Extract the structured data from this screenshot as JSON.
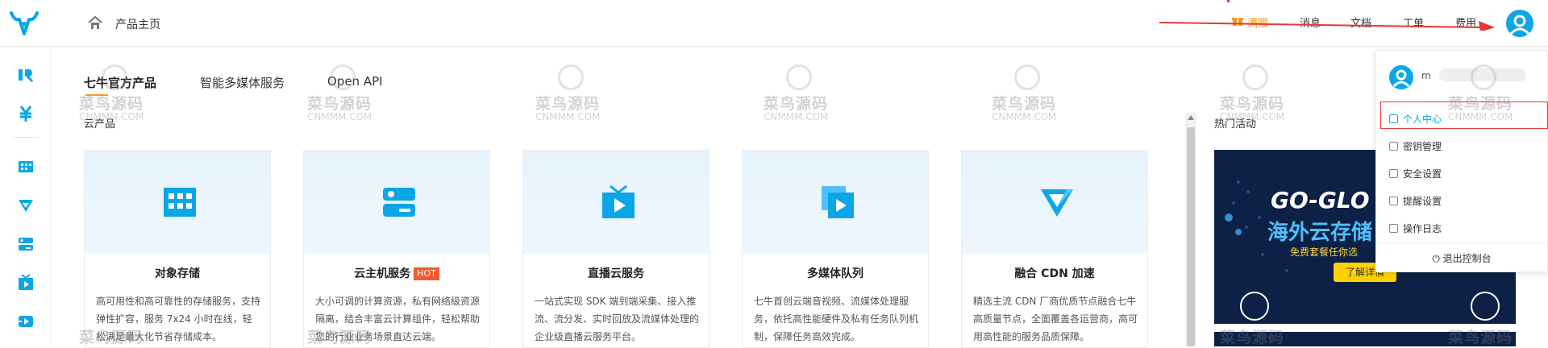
{
  "topbar": {
    "breadcrumb": "产品主页",
    "nav": [
      {
        "label": "满赠",
        "promo": true
      },
      {
        "label": "消息"
      },
      {
        "label": "文档"
      },
      {
        "label": "工单"
      },
      {
        "label": "费用"
      }
    ]
  },
  "tabs": [
    {
      "label": "七牛官方产品",
      "active": true
    },
    {
      "label": "智能多媒体服务"
    },
    {
      "label": "Open API"
    }
  ],
  "section_title": "云产品",
  "products": [
    {
      "title": "对象存储",
      "desc": "高可用性和高可靠性的存储服务，支持弹性扩容，服务 7x24 小时在线，轻松满足最大化节省存储成本。",
      "icon": "object-storage-icon"
    },
    {
      "title": "云主机服务",
      "badge": "HOT",
      "desc": "大小可调的计算资源，私有网络级资源隔离，结合丰富云计算组件，轻松帮助您的行业业务场景直达云端。",
      "icon": "cloud-host-icon"
    },
    {
      "title": "直播云服务",
      "desc": "一站式实现 SDK 端到端采集、接入推流、流分发、实时回放及流媒体处理的企业级直播云服务平台。",
      "icon": "live-tv-icon"
    },
    {
      "title": "多媒体队列",
      "desc": "七牛首创云端音视频、流媒体处理服务，依托高性能硬件及私有任务队列机制，保障任务高效完成。",
      "icon": "media-queue-icon"
    },
    {
      "title": "融合 CDN 加速",
      "desc": "精选主流 CDN 厂商优质节点融合七牛高质量节点，全面覆盖各运营商，高可用高性能的服务品质保障。",
      "icon": "cdn-icon"
    }
  ],
  "hot": {
    "title": "热门活动",
    "banner": {
      "headline_en": "GO-GLO",
      "headline_cn": "海外云存储",
      "sub": "免费套餐任你选",
      "button": "了解详情"
    }
  },
  "dropdown": {
    "username": "m",
    "items": [
      {
        "label": "个人中心",
        "active": true
      },
      {
        "label": "密钥管理"
      },
      {
        "label": "安全设置"
      },
      {
        "label": "提醒设置"
      },
      {
        "label": "操作日志"
      }
    ],
    "logout": "退出控制台"
  },
  "watermark": {
    "cn": "菜鸟源码",
    "en": "CNMMM.COM"
  },
  "colors": {
    "accent": "#0aa6e6",
    "promo": "#f29c1f",
    "hot": "#f25a2a",
    "annotation": "#e53935"
  }
}
